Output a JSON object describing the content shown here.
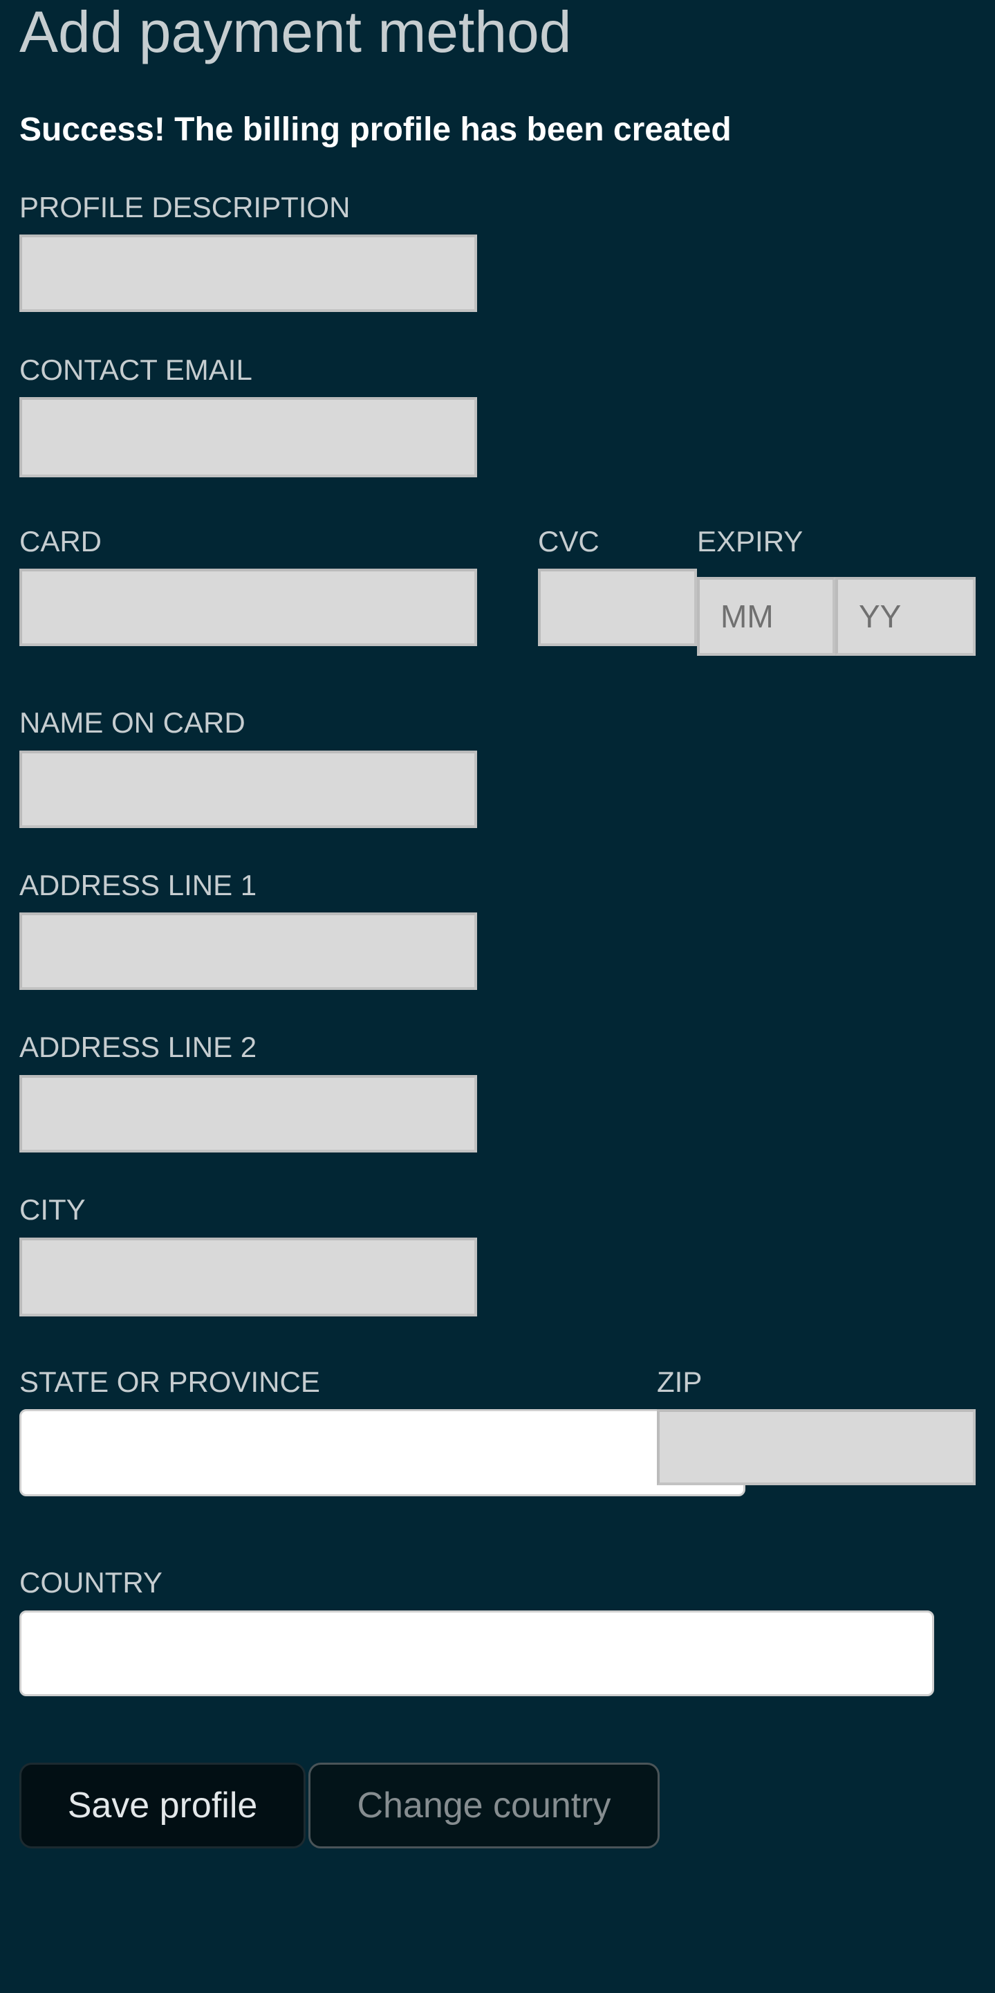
{
  "header": {
    "title": "Add payment method"
  },
  "status": {
    "message": "Success! The billing profile has been created"
  },
  "form": {
    "profile_description": {
      "label": "PROFILE DESCRIPTION",
      "value": ""
    },
    "contact_email": {
      "label": "CONTACT EMAIL",
      "value": ""
    },
    "card": {
      "label": "CARD",
      "value": ""
    },
    "cvc": {
      "label": "CVC",
      "value": ""
    },
    "expiry": {
      "label": "EXPIRY",
      "month_placeholder": "MM",
      "year_placeholder": "YY"
    },
    "name_on_card": {
      "label": "NAME ON CARD",
      "value": ""
    },
    "address_line_1": {
      "label": "ADDRESS LINE 1",
      "value": ""
    },
    "address_line_2": {
      "label": "ADDRESS LINE 2",
      "value": ""
    },
    "city": {
      "label": "CITY",
      "value": ""
    },
    "state_or_province": {
      "label": "STATE OR PROVINCE",
      "value": ""
    },
    "zip": {
      "label": "ZIP",
      "value": ""
    },
    "country": {
      "label": "COUNTRY",
      "value": ""
    }
  },
  "actions": {
    "save_label": "Save profile",
    "change_country_label": "Change country"
  },
  "colors": {
    "background": "#022634",
    "field": "#d9d9d9",
    "label": "#c6cdd0",
    "success_text": "#ffffff"
  }
}
